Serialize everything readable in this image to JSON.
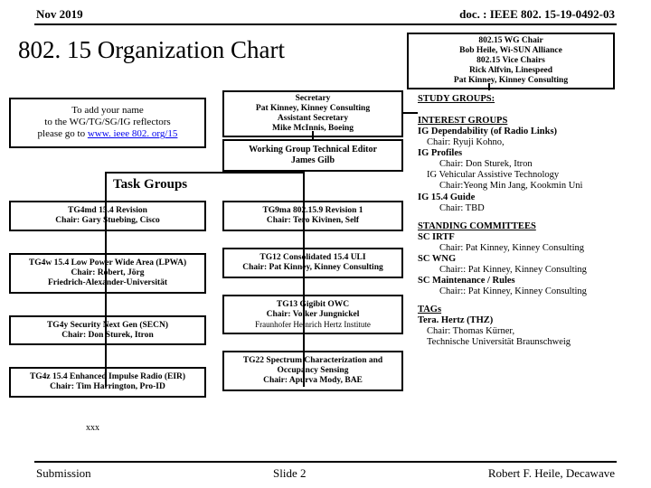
{
  "header": {
    "date": "Nov 2019",
    "doc": "doc. : IEEE 802. 15-19-0492-03"
  },
  "title": "802. 15 Organization Chart",
  "wg_chair": {
    "l1": "802.15 WG Chair",
    "l2": "Bob Heile, Wi-SUN Alliance",
    "l3": "802.15 Vice Chairs",
    "l4": "Rick Alfvin, Linespeed",
    "l5": "Pat Kinney, Kinney Consulting"
  },
  "note": {
    "l1": "To add your name",
    "l2": "to the WG/TG/SG/IG reflectors",
    "l3a": "please go to ",
    "l3b": "www. ieee 802. org/15"
  },
  "sec": {
    "l1": "Secretary",
    "l2": "Pat Kinney, Kinney Consulting",
    "l3": "Assistant Secretary",
    "l4": "Mike McInnis, Boeing"
  },
  "editor": {
    "l1": "Working Group Technical Editor",
    "l2": "James Gilb"
  },
  "task_hdr": "Task Groups",
  "tg_col1": [
    {
      "t": "TG4md 15.4 Revision",
      "c": "Chair: Gary Stuebing, Cisco"
    },
    {
      "t": "TG4w 15.4 Low Power Wide Area (LPWA)",
      "c": "Chair: Robert, Jörg\nFriedrich-Alexander-Universität"
    },
    {
      "t": "TG4y Security Next Gen (SECN)",
      "c": "Chair: Don Sturek, Itron"
    },
    {
      "t": "TG4z 15.4 Enhanced Impulse Radio (EIR)",
      "c": "Chair: Tim Harrington, Pro-ID"
    }
  ],
  "tg_col2": [
    {
      "t": "TG9ma 802.15.9 Revision 1",
      "c": "Chair: Tero Kivinen, Self"
    },
    {
      "t": "TG12 Consolidated 15.4 ULI",
      "c": "Chair: Pat Kinney, Kinney Consulting"
    },
    {
      "t": "TG13 Gigibit OWC",
      "c": "Chair: Volker Jungnickel",
      "c2": "Fraunhofer Heinrich Hertz Institute"
    },
    {
      "t": "TG22 Spectrum Characterization\nand Occupancy Sensing",
      "c": "Chair: Apurva Mody, BAE"
    }
  ],
  "side": {
    "sg_hdr": "STUDY GROUPS:",
    "ig_hdr": "INTEREST GROUPS",
    "ig1": "IG Dependability (of Radio Links)",
    "ig1c": "Chair: Ryuji Kohno,",
    "ig2": "IG Profiles",
    "ig2c": "Chair: Don Sturek, Itron",
    "ig3": "IG Vehicular Assistive Technology",
    "ig3c": "Chair:Yeong Min Jang, Kookmin Uni",
    "ig4": "IG 15.4 Guide",
    "ig4c": "Chair: TBD",
    "sc_hdr": "STANDING COMMITTEES",
    "sc1": "SC IRTF",
    "sc1c": "Chair: Pat Kinney, Kinney Consulting",
    "sc2": "SC WNG",
    "sc2c": "Chair:: Pat Kinney, Kinney Consulting",
    "sc3": "SC Maintenance / Rules",
    "sc3c": "Chair:: Pat Kinney, Kinney Consulting",
    "tags_hdr": "TAGs",
    "tag1": "Tera. Hertz (THZ)",
    "tag1c1": "Chair: Thomas Kürner,",
    "tag1c2": "  Technische Universität Braunschweig"
  },
  "xxx": "xxx",
  "footer": {
    "left": "Submission",
    "center": "Slide 2",
    "right": "Robert F. Heile, Decawave"
  }
}
